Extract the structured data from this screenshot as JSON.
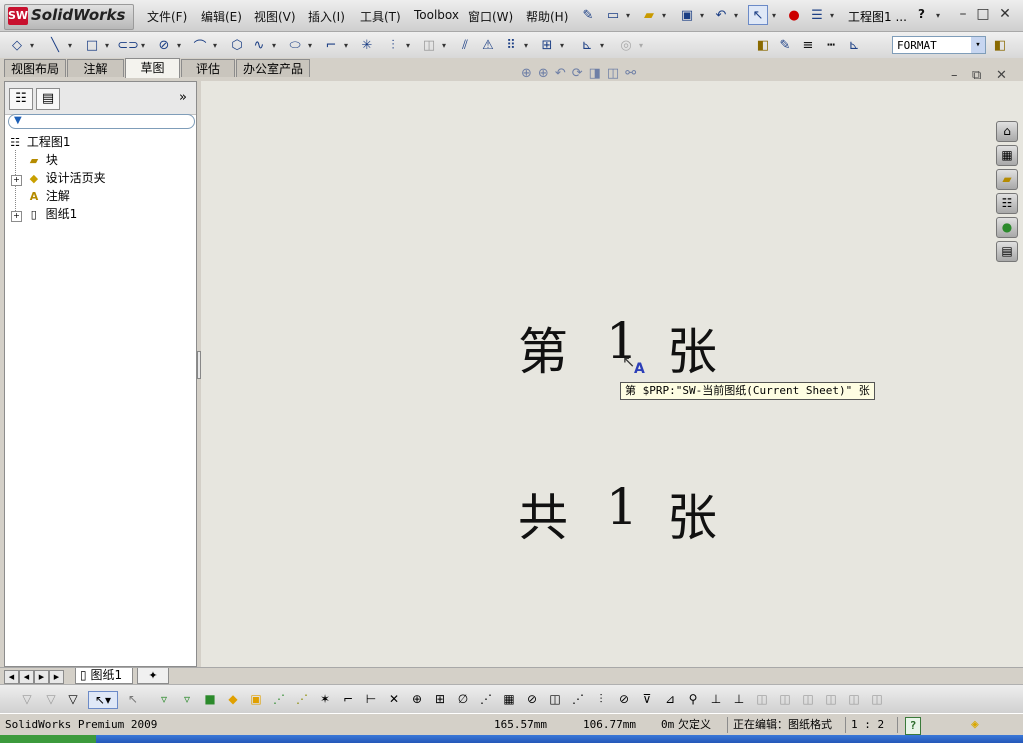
{
  "app": {
    "logo_mark": "SW",
    "logo_text": "SolidWorks",
    "doc_title": "工程图1 ...",
    "help_label": "?"
  },
  "menu": {
    "items": [
      "文件(F)",
      "编辑(E)",
      "视图(V)",
      "插入(I)",
      "工具(T)",
      "Toolbox",
      "窗口(W)",
      "帮助(H)"
    ]
  },
  "toolbar": {
    "layer_combo_value": "FORMAT",
    "layer_combo_arrow": "▾"
  },
  "command_tabs": [
    "视图布局",
    "注解",
    "草图",
    "评估",
    "办公室产品"
  ],
  "active_tab": "草图",
  "feature_tree": {
    "collapse_label": "»",
    "items": [
      {
        "label": "工程图1",
        "icon": "drawing-icon"
      },
      {
        "label": "块",
        "icon": "block-folder-icon"
      },
      {
        "label": "设计活页夹",
        "icon": "design-binder-icon"
      },
      {
        "label": "注解",
        "icon": "annotations-folder-icon"
      },
      {
        "label": "图纸1",
        "icon": "sheet-icon"
      }
    ],
    "expanders": [
      "+",
      "+"
    ]
  },
  "canvas": {
    "line1": {
      "left": "第",
      "mid": "1",
      "right": "张"
    },
    "line2": {
      "left": "共",
      "mid": "1",
      "right": "张"
    },
    "tooltip": "第 $PRP:\"SW-当前图纸(Current Sheet)\" 张",
    "note_marker": "A"
  },
  "sheet_tabs": {
    "active": "图纸1"
  },
  "status": {
    "product": "SolidWorks Premium 2009",
    "x": "165.57mm",
    "y": "106.77mm",
    "z": "0m",
    "constraint": "欠定义",
    "editing": "正在编辑：图纸格式",
    "scale": "1 : 2",
    "help_icon_label": "?"
  },
  "colors": {
    "canvas_bg": "#e7e6df",
    "brand_red": "#c8102e",
    "tooltip_bg": "#fefde2"
  }
}
